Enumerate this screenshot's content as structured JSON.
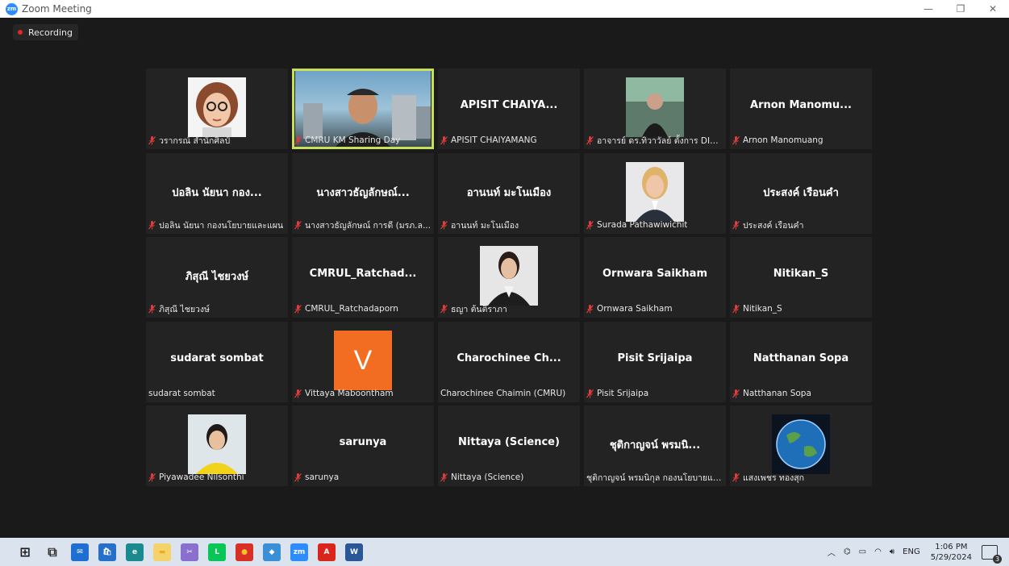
{
  "window": {
    "title": "Zoom Meeting",
    "minimize": "—",
    "restore": "❐",
    "close": "✕"
  },
  "recording": {
    "label": "Recording"
  },
  "tiles": [
    {
      "name_big": "",
      "label": "วรากรณ์ สำนักศิลป์",
      "muted": true,
      "photo": "cartoon-avatar"
    },
    {
      "name_big": "",
      "label": "CMRU KM Sharing Day",
      "muted": true,
      "photo": "video-man",
      "active": true
    },
    {
      "name_big": "APISIT CHAIYA...",
      "label": "APISIT CHAIYAMANG",
      "muted": true
    },
    {
      "name_big": "",
      "label": "อาจารย์ ดร.ทิวาวัลย์ ตั้งการ DIG...",
      "muted": true,
      "photo": "video-woman"
    },
    {
      "name_big": "Arnon Manomu...",
      "label": "Arnon Manomuang",
      "muted": true
    },
    {
      "name_big": "ปอลิน นัยนา กอง...",
      "label": "ปอลิน นัยนา กองนโยบายและแผน",
      "muted": true
    },
    {
      "name_big": "นางสาวธัญลักษณ์...",
      "label": "นางสาวธัญลักษณ์ การดี (มรภ.ล...",
      "muted": true
    },
    {
      "name_big": "อานนท์ มะโนเมือง",
      "label": "อานนท์ มะโนเมือง",
      "muted": true
    },
    {
      "name_big": "",
      "label": "Surada Pathawiwichit",
      "muted": true,
      "photo": "portrait-woman"
    },
    {
      "name_big": "ประสงค์ เรือนคำ",
      "label": "ประสงค์ เรือนคำ",
      "muted": true
    },
    {
      "name_big": "ภิสุณี ไชยวงษ์",
      "label": "ภิสุณี ไชยวงษ์",
      "muted": true
    },
    {
      "name_big": "CMRUL_Ratchad...",
      "label": "CMRUL_Ratchadaporn",
      "muted": true
    },
    {
      "name_big": "",
      "label": "ธญา ต้นติราภา",
      "muted": true,
      "photo": "portrait-woman2"
    },
    {
      "name_big": "Ornwara Saikham",
      "label": "Ornwara Saikham",
      "muted": true
    },
    {
      "name_big": "Nitikan_S",
      "label": "Nitikan_S",
      "muted": true
    },
    {
      "name_big": "sudarat sombat",
      "label": "sudarat sombat",
      "muted": false
    },
    {
      "name_big": "",
      "label": "Vittaya Maboontham",
      "muted": true,
      "photo": "letter-v",
      "letter": "V"
    },
    {
      "name_big": "Charochinee Ch...",
      "label": "Charochinee Chaimin (CMRU)",
      "muted": false
    },
    {
      "name_big": "Pisit Srijaipa",
      "label": "Pisit Srijaipa",
      "muted": true
    },
    {
      "name_big": "Natthanan Sopa",
      "label": "Natthanan Sopa",
      "muted": true
    },
    {
      "name_big": "",
      "label": "Piyawadee Nilsonthi",
      "muted": true,
      "photo": "portrait-yellow"
    },
    {
      "name_big": "sarunya",
      "label": "sarunya",
      "muted": true
    },
    {
      "name_big": "Nittaya (Science)",
      "label": "Nittaya (Science)",
      "muted": true
    },
    {
      "name_big": "ชุติกาญจน์ พรมนิ...",
      "label": "ชุติกาญจน์ พรมนิกุล กองนโยบายแล...",
      "muted": false
    },
    {
      "name_big": "",
      "label": "แสงเพชร ทองสุก",
      "muted": true,
      "photo": "earth"
    }
  ],
  "taskbar": {
    "apps": [
      "windows-start-icon",
      "task-view-icon",
      "mail-icon",
      "store-icon",
      "edge-icon",
      "file-explorer-icon",
      "snip-icon",
      "line-icon",
      "chrome-icon",
      "app-icon",
      "zoom-icon",
      "pdf-icon",
      "word-icon"
    ],
    "tray": {
      "lang": "ENG",
      "time": "1:06 PM",
      "date": "5/29/2024",
      "notif_count": "3"
    }
  }
}
